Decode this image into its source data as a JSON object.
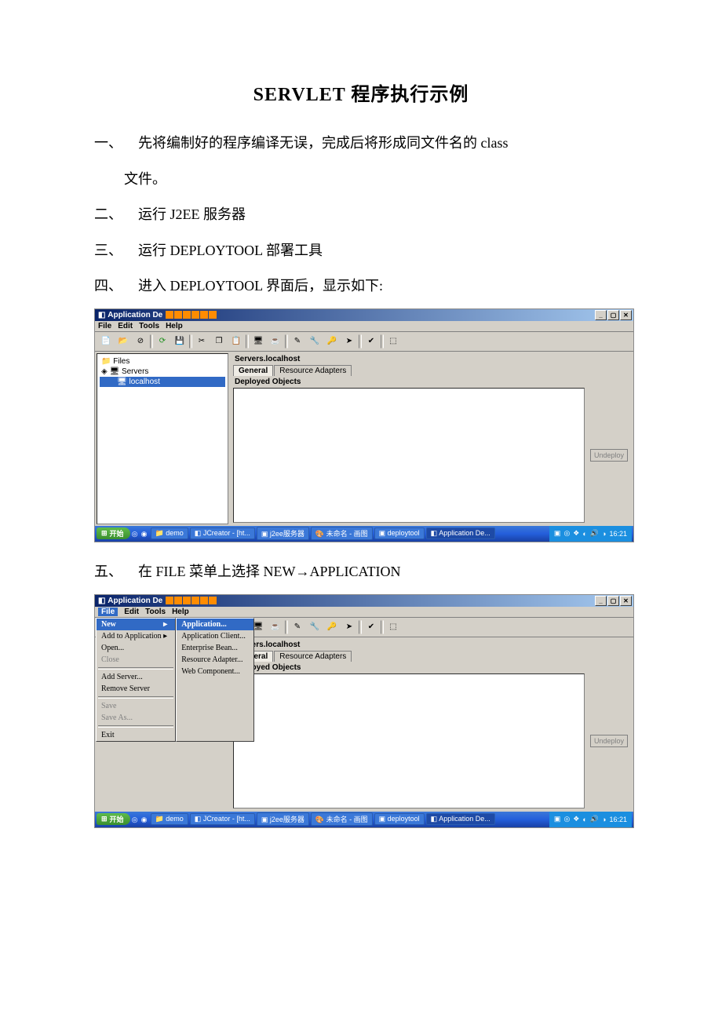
{
  "doc": {
    "title": "SERVLET 程序执行示例",
    "items": {
      "i1a": "一、",
      "i1b": "先将编制好的程序编译无误，完成后将形成同文件名的 class",
      "i1c": "文件。",
      "i2a": "二、",
      "i2b": "运行 J2EE 服务器",
      "i3a": "三、",
      "i3b": "运行 DEPLOYTOOL 部署工具",
      "i4a": "四、",
      "i4b": "进入 DEPLOYTOOL 界面后，显示如下:",
      "i5a": "五、",
      "i5b": "在 FILE 菜单上选择 NEW→APPLICATION"
    }
  },
  "app": {
    "title": "Application De",
    "menus": {
      "file": "File",
      "edit": "Edit",
      "tools": "Tools",
      "help": "Help"
    },
    "tree": {
      "files": "Files",
      "servers": "Servers",
      "localhost": "localhost"
    },
    "panel": {
      "heading": "Servers.localhost",
      "tab_general": "General",
      "tab_resource": "Resource Adapters",
      "deployed": "Deployed Objects"
    },
    "undeploy": "Undeploy",
    "file_menu": {
      "new": "New",
      "add": "Add to Application  ▸",
      "open": "Open...",
      "close": "Close",
      "add_server": "Add Server...",
      "remove_server": "Remove Server",
      "save": "Save",
      "save_as": "Save As...",
      "exit": "Exit"
    },
    "new_submenu": {
      "application": "Application...",
      "app_client": "Application Client...",
      "ejb": "Enterprise Bean...",
      "resource": "Resource Adapter...",
      "web": "Web Component..."
    }
  },
  "taskbar": {
    "start": "开始",
    "items": {
      "demo": "demo",
      "jcreator": "JCreator - [ht...",
      "j2ee": "j2ee服务器",
      "paint": "未命名 - 画图",
      "deploytool": "deploytool",
      "appde": "Application De..."
    },
    "time": "16:21"
  }
}
